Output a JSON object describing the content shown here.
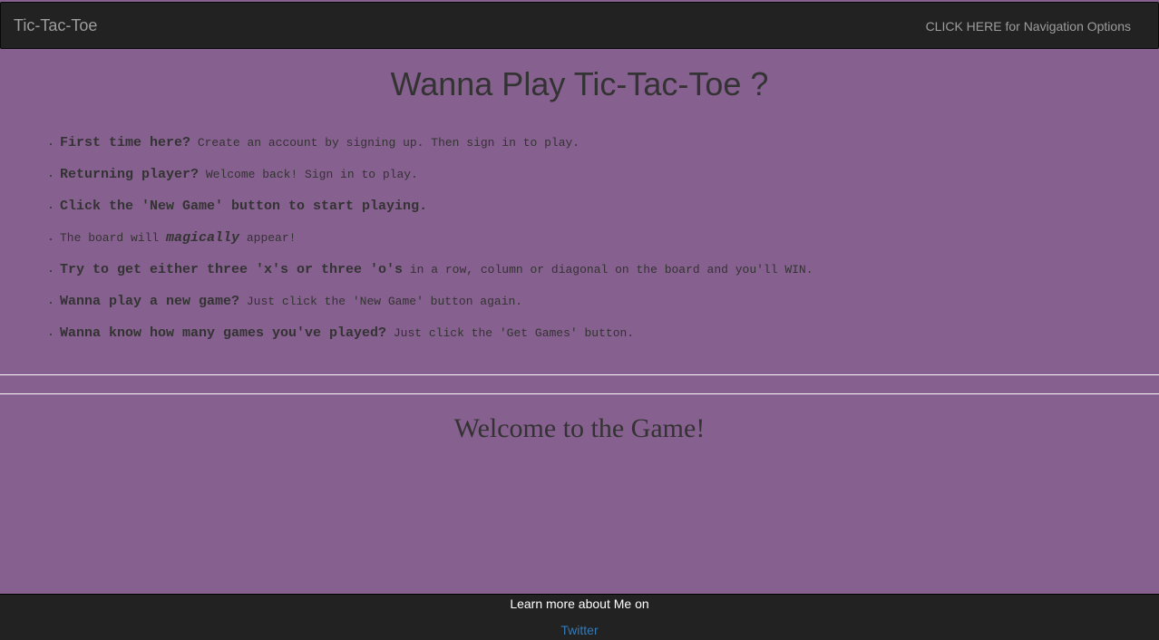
{
  "navbar": {
    "brand": "Tic-Tac-Toe",
    "nav_link": "CLICK HERE for Navigation Options"
  },
  "main": {
    "title": "Wanna Play Tic-Tac-Toe ?",
    "instructions": [
      {
        "strong": "First time here?",
        "text": " Create an account by signing up. Then sign in to play."
      },
      {
        "strong": "Returning player?",
        "text": " Welcome back! Sign in to play."
      },
      {
        "strong": "Click the 'New Game' button to start playing.",
        "text": ""
      },
      {
        "pre": "The board will ",
        "em": "magically",
        "post": " appear!"
      },
      {
        "strong": "Try to get either three 'x's or three 'o's",
        "text": " in a row, column or diagonal on the board and you'll WIN."
      },
      {
        "strong": "Wanna play a new game?",
        "text": " Just click the 'New Game' button again."
      },
      {
        "strong": "Wanna know how many games you've played?",
        "text": " Just click the 'Get Games' button."
      }
    ],
    "game_message": "Welcome to the Game!"
  },
  "footer": {
    "text": "Learn more about Me on",
    "link": "Twitter"
  },
  "colors": {
    "background": "#86608e",
    "navbar": "#222222",
    "link": "#337ab7"
  }
}
